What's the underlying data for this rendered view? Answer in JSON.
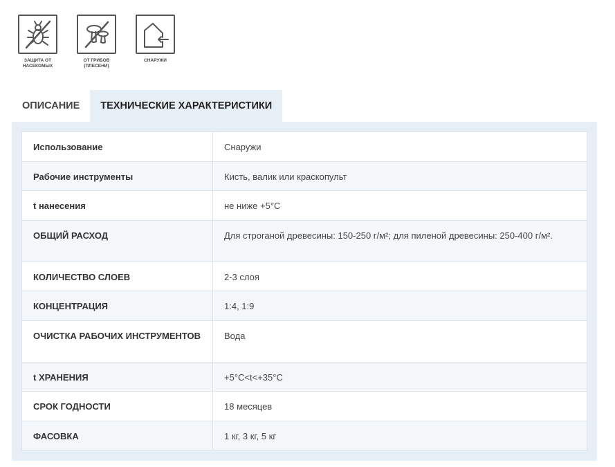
{
  "icons": [
    {
      "name": "insect-protection-icon",
      "caption": "ЗАЩИТА ОТ НАСЕКОМЫХ"
    },
    {
      "name": "fungus-protection-icon",
      "caption": "ОТ ГРИБОВ (ПЛЕСЕНИ)"
    },
    {
      "name": "outdoor-use-icon",
      "caption": "СНАРУЖИ"
    }
  ],
  "tabs": [
    {
      "label": "ОПИСАНИЕ",
      "active": false
    },
    {
      "label": "ТЕХНИЧЕСКИЕ ХАРАКТЕРИСТИКИ",
      "active": true
    }
  ],
  "specs": [
    {
      "key": "Использование",
      "value": "Снаружи"
    },
    {
      "key": "Рабочие инструменты",
      "value": "Кисть, валик или краскопульт"
    },
    {
      "key": "t нанесения",
      "value": "не ниже +5°C"
    },
    {
      "key": "ОБЩИЙ РАСХОД",
      "value": "Для строганой древесины: 150-250 г/м²; для пиленой древесины: 250-400 г/м²."
    },
    {
      "key": "КОЛИЧЕСТВО СЛОЕВ",
      "value": "2-3 слоя"
    },
    {
      "key": "КОНЦЕНТРАЦИЯ",
      "value": "1:4, 1:9"
    },
    {
      "key": "ОЧИСТКА РАБОЧИХ ИНСТРУМЕНТОВ",
      "value": "Вода"
    },
    {
      "key": "t ХРАНЕНИЯ",
      "value": "+5°C<t<+35°C"
    },
    {
      "key": "СРОК ГОДНОСТИ",
      "value": "18 месяцев"
    },
    {
      "key": "ФАСОВКА",
      "value": "1 кг, 3 кг, 5 кг"
    }
  ]
}
